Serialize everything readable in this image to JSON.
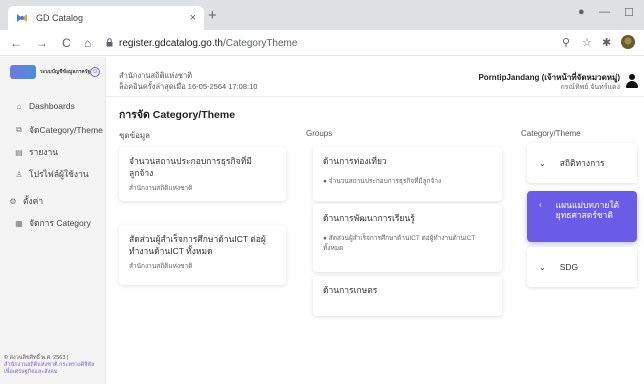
{
  "browser": {
    "tab_title": "GD Catalog",
    "tab_close": "×",
    "new_tab": "+",
    "url_host": "register.gdcatalog.go.th",
    "url_path": "/CategoryTheme",
    "back": "←",
    "forward": "→",
    "reload": "C",
    "home": "⌂",
    "lock": "🔒",
    "window": {
      "minimize": "—",
      "maximize": "☐",
      "close": "✕"
    }
  },
  "sidebar": {
    "logo_text": "ระบบบัญชีข้อมูลภาครัฐ",
    "collapse": "⊙",
    "items": [
      {
        "label": "Dashboards",
        "icon": "home-icon"
      },
      {
        "label": "จัดCategory/Theme",
        "icon": "tag-icon"
      },
      {
        "label": "รายงาน",
        "icon": "report-icon"
      },
      {
        "label": "โปรไฟล์ผู้ใช้งาน",
        "icon": "user-icon"
      }
    ],
    "section_label": "ตั้งค่า",
    "section_items": [
      {
        "label": "จัดการ Category",
        "icon": "grid-icon"
      }
    ],
    "footer_copy": "© สงวนลิขสิทธิ์ พ.ศ. 2563 |",
    "footer_org": "สำนักงานสถิติแห่งชาติ กระทรวงดิจิทัลเพื่อเศรษฐกิจและสังคม"
  },
  "header": {
    "org_name": "สำนักงานสถิติแห่งชาติ",
    "last_login": "ล็อคอินครั้งล่าสุดเมื่อ 16-05-2564 17:08:10",
    "user_name": "PorntipJandang (เจ้าหน้าที่จัดหมวดหมู่)",
    "user_org": "กรณ์ทิพย์ จันทร์แดง"
  },
  "page": {
    "title": "การจัด Category/Theme",
    "columns": {
      "datasets": "ชุดข้อมูล",
      "groups": "Groups",
      "categories": "Category/Theme"
    }
  },
  "datasets": [
    {
      "title": "จำนวนสถานประกอบการธุรกิจที่มีลูกจ้าง",
      "org": "สำนักงานสถิติแห่งชาติ"
    },
    {
      "title": "สัดส่วนผู้สำเร็จการศึกษาด้านICT ต่อผู้ทำงานด้านICT ทั้งหมด",
      "org": "สำนักงานสถิติแห่งชาติ"
    }
  ],
  "groups": [
    {
      "title": "ด้านการท่องเที่ยว",
      "items": [
        "● จำนวนสถานประกอบการธุรกิจที่มีลูกจ้าง"
      ]
    },
    {
      "title": "ด้านการพัฒนาการเรียนรู้",
      "items": [
        "● สัดส่วนผู้สำเร็จการศึกษาด้านICT ต่อผู้ทำงานด้านICT ทั้งหมด"
      ]
    },
    {
      "title": "ด้านการเกษตร",
      "items": []
    }
  ],
  "categories": [
    {
      "label": "สถิติทางการ",
      "chevron": "⌄",
      "active": false
    },
    {
      "label": "แผนแม่บทภายใต้ยุทธศาสตร์ชาติ",
      "chevron": "‹",
      "active": true
    },
    {
      "label": "SDG",
      "chevron": "⌄",
      "active": false
    }
  ],
  "colors": {
    "accent": "#6b5ce7",
    "sidebar_bg": "#f4f4f4"
  }
}
